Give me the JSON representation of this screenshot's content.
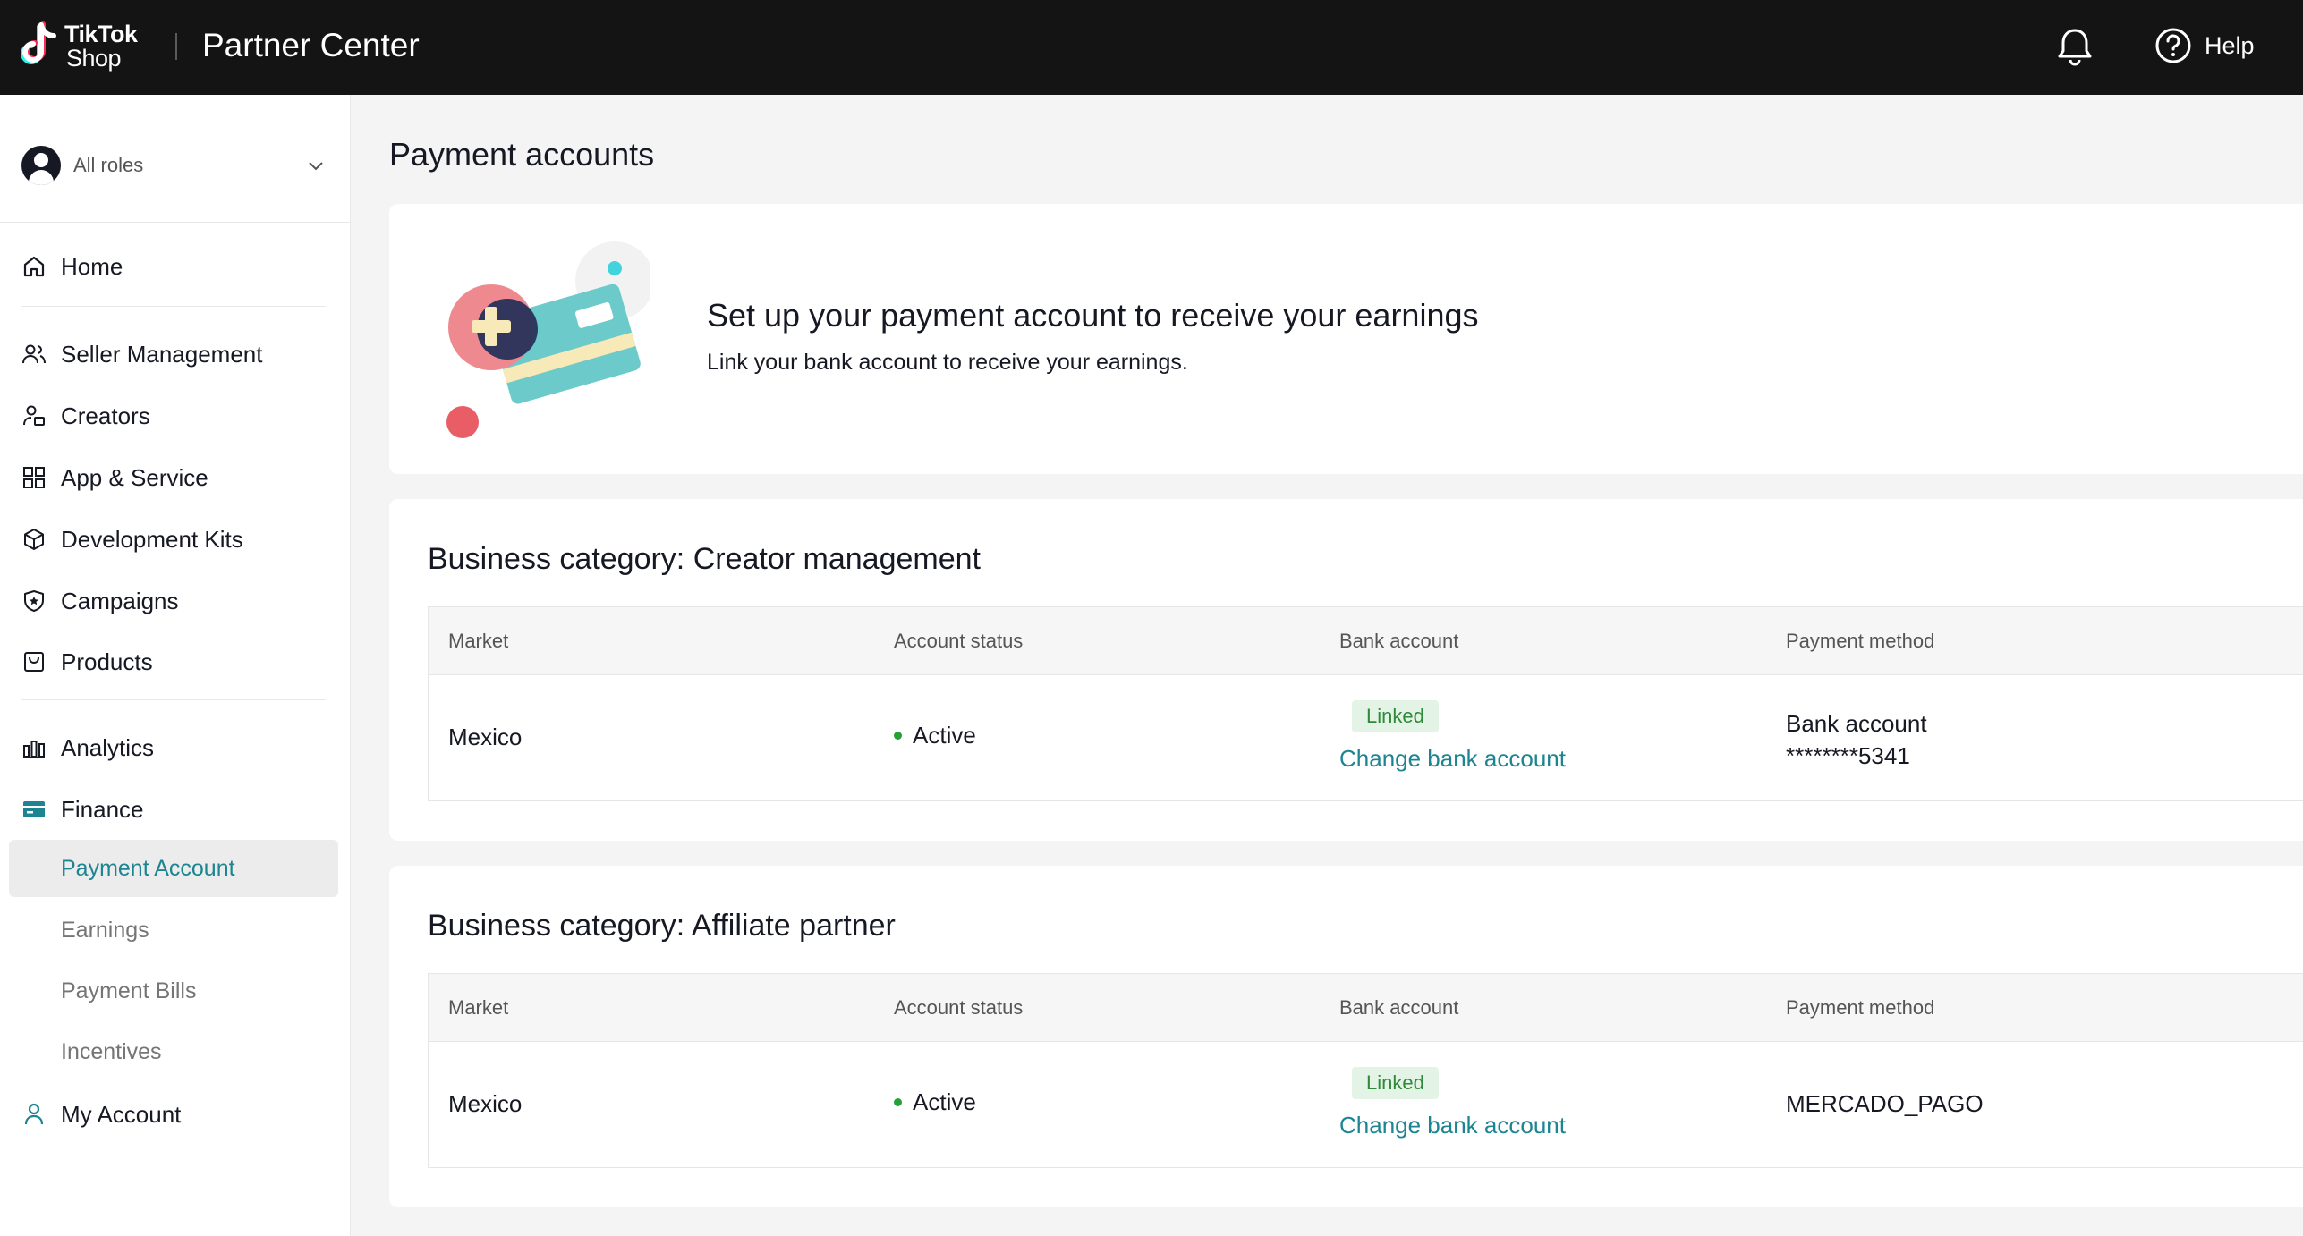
{
  "header": {
    "logo_line1": "TikTok",
    "logo_line2": "Shop",
    "app_title": "Partner Center",
    "help_label": "Help"
  },
  "sidebar": {
    "role_label": "All roles",
    "items": [
      {
        "label": "Home",
        "icon": "home-icon"
      },
      {
        "label": "Seller Management",
        "icon": "users-icon"
      },
      {
        "label": "Creators",
        "icon": "creator-icon"
      },
      {
        "label": "App & Service",
        "icon": "apps-grid-icon"
      },
      {
        "label": "Development Kits",
        "icon": "cube-icon"
      },
      {
        "label": "Campaigns",
        "icon": "shield-icon"
      },
      {
        "label": "Products",
        "icon": "bag-icon"
      },
      {
        "label": "Analytics",
        "icon": "bar-chart-icon"
      },
      {
        "label": "Finance",
        "icon": "wallet-icon"
      },
      {
        "label": "My Account",
        "icon": "person-icon"
      }
    ],
    "finance_sub": [
      "Payment Account",
      "Earnings",
      "Payment Bills",
      "Incentives"
    ],
    "active_sub": "Payment Account"
  },
  "main": {
    "title": "Payment accounts",
    "banner": {
      "title": "Set up your payment account to receive your earnings",
      "subtitle": "Link your bank account to receive your earnings."
    },
    "columns": [
      "Market",
      "Account status",
      "Bank account",
      "Payment method"
    ],
    "categories": [
      {
        "title": "Business category: Creator management",
        "row": {
          "market": "Mexico",
          "status": "Active",
          "bank_badge": "Linked",
          "bank_link": "Change bank account",
          "payment_method_line1": "Bank account",
          "payment_method_line2": "********5341"
        }
      },
      {
        "title": "Business category: Affiliate partner",
        "row": {
          "market": "Mexico",
          "status": "Active",
          "bank_badge": "Linked",
          "bank_link": "Change bank account",
          "payment_method": "MERCADO_PAGO"
        }
      }
    ]
  },
  "colors": {
    "topbar": "#141414",
    "accent": "#1c8591",
    "active_status": "#27a037",
    "linked_badge_bg": "#e3f3e5"
  }
}
